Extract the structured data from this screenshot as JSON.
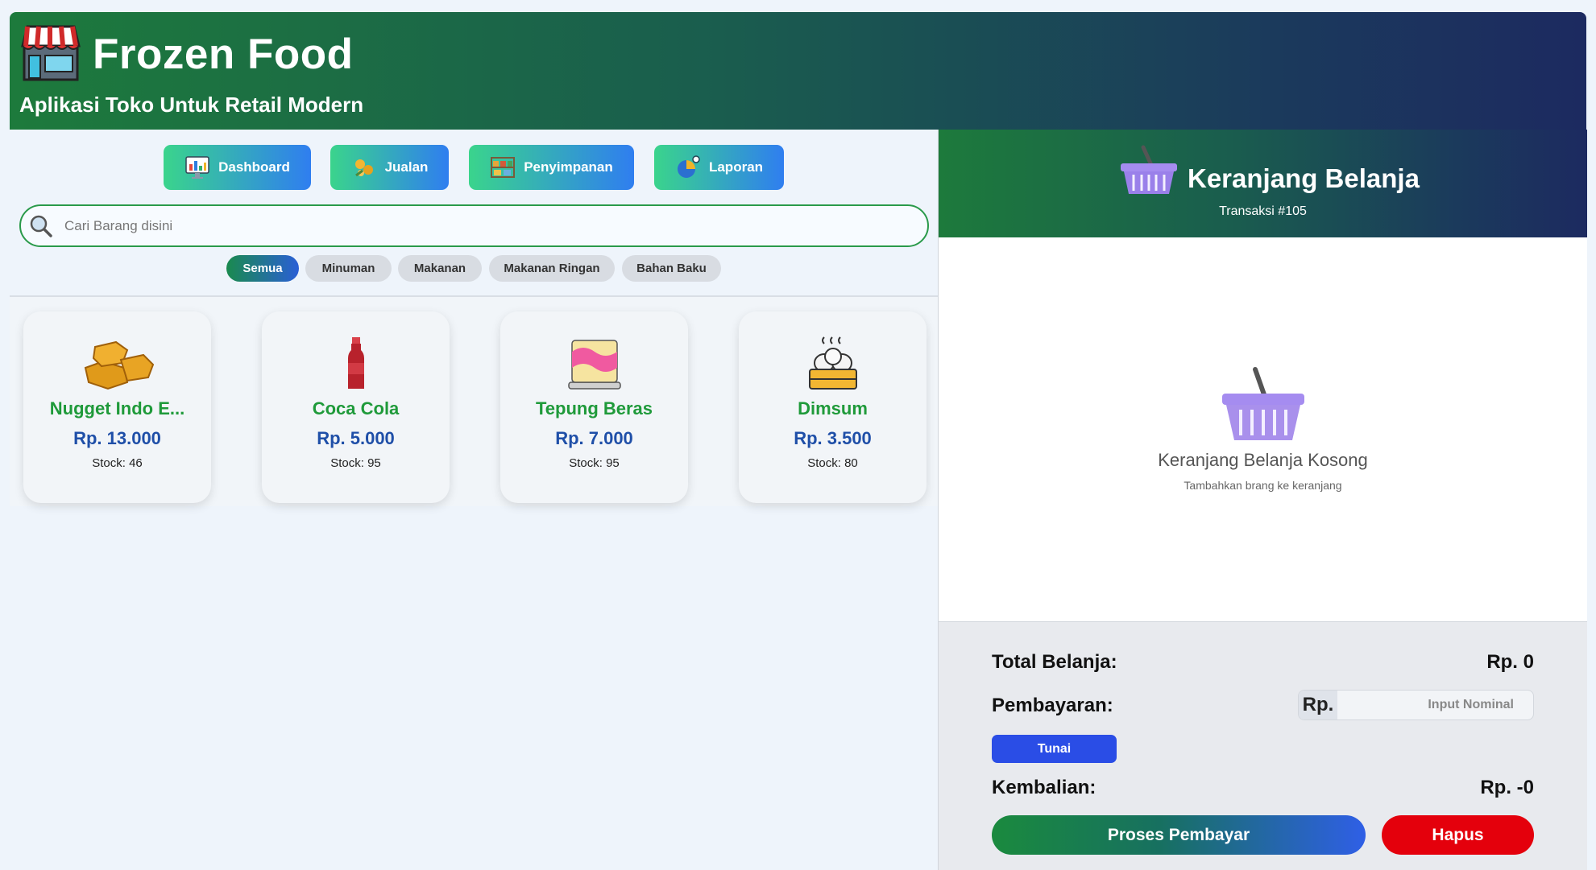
{
  "header": {
    "title": "Frozen Food",
    "subtitle": "Aplikasi Toko Untuk Retail Modern",
    "logo_icon": "store-icon"
  },
  "nav": [
    {
      "label": "Dashboard",
      "icon": "dashboard-icon"
    },
    {
      "label": "Jualan",
      "icon": "sales-icon"
    },
    {
      "label": "Penyimpanan",
      "icon": "storage-icon"
    },
    {
      "label": "Laporan",
      "icon": "report-icon"
    }
  ],
  "search": {
    "placeholder": "Cari Barang disini",
    "value": ""
  },
  "filters": [
    {
      "label": "Semua",
      "active": true
    },
    {
      "label": "Minuman",
      "active": false
    },
    {
      "label": "Makanan",
      "active": false
    },
    {
      "label": "Makanan Ringan",
      "active": false
    },
    {
      "label": "Bahan Baku",
      "active": false
    }
  ],
  "products": [
    {
      "name": "Nugget Indo E...",
      "price": "Rp. 13.000",
      "stock": "Stock: 46",
      "icon": "nugget-icon"
    },
    {
      "name": "Coca Cola",
      "price": "Rp. 5.000",
      "stock": "Stock: 95",
      "icon": "bottle-icon"
    },
    {
      "name": "Tepung Beras",
      "price": "Rp. 7.000",
      "stock": "Stock: 95",
      "icon": "cake-icon"
    },
    {
      "name": "Dimsum",
      "price": "Rp. 3.500",
      "stock": "Stock: 80",
      "icon": "dimsum-icon"
    }
  ],
  "cart": {
    "title": "Keranjang Belanja",
    "transaction": "Transaksi #105",
    "empty_title": "Keranjang Belanja Kosong",
    "empty_subtitle": "Tambahkan brang ke keranjang"
  },
  "summary": {
    "total_label": "Total Belanja:",
    "total_value": "Rp. 0",
    "payment_label": "Pembayaran:",
    "payment_prefix": "Rp.",
    "payment_placeholder": "Input Nominal",
    "payment_method": "Tunai",
    "change_label": "Kembalian:",
    "change_value": "Rp. -0",
    "process_label": "Proses Pembayar",
    "delete_label": "Hapus"
  },
  "colors": {
    "header_start": "#1d7a3c",
    "header_end": "#1c2a60",
    "product_name": "#1f9a3a",
    "product_price": "#1f4fa8",
    "delete": "#e4000c",
    "tunai": "#2a4de6"
  }
}
